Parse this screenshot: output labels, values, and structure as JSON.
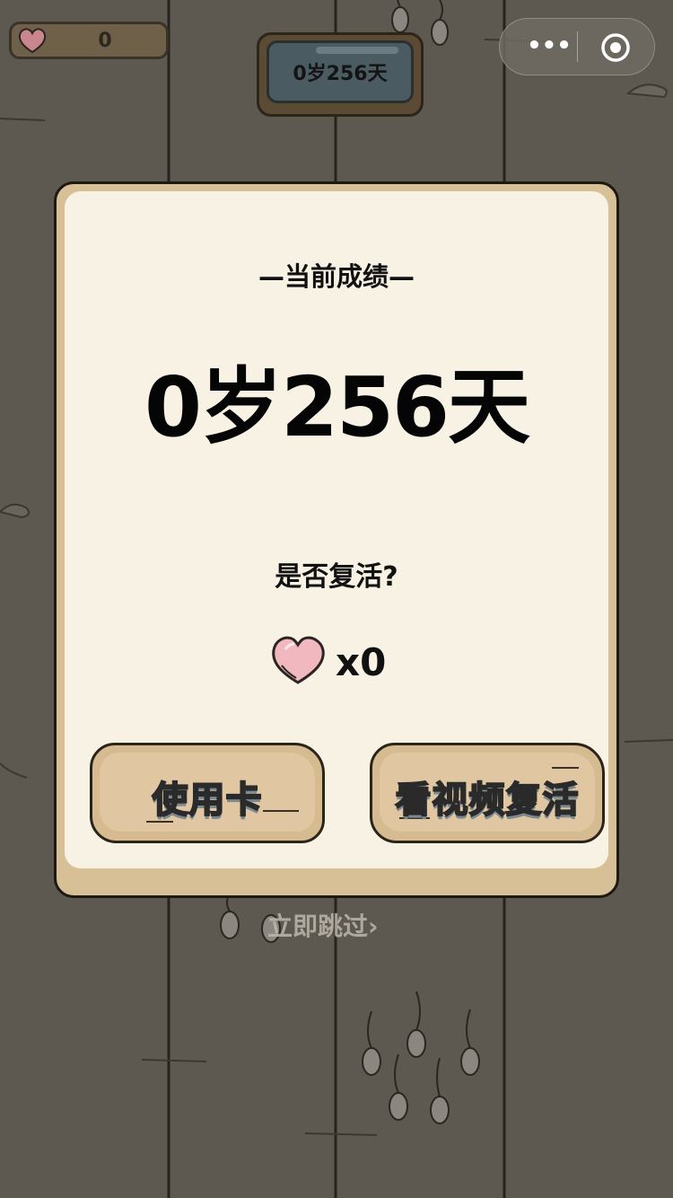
{
  "hud": {
    "hearts_count": "0",
    "score": "0岁256天"
  },
  "capsule": {
    "more_label": "•••"
  },
  "dialog": {
    "heading": "—当前成绩—",
    "score": "0岁256天",
    "question": "是否复活?",
    "revive_cards": "x0",
    "use_card_button": "使用卡",
    "watch_video_button": "看视频复活"
  },
  "skip_label": "立即跳过›",
  "colors": {
    "background": "#5d5850",
    "dialog_frame": "#d7bf96",
    "dialog_panel": "#f8f2e4",
    "heart": "#f0b6be",
    "button_stone": "#d6ba90"
  }
}
